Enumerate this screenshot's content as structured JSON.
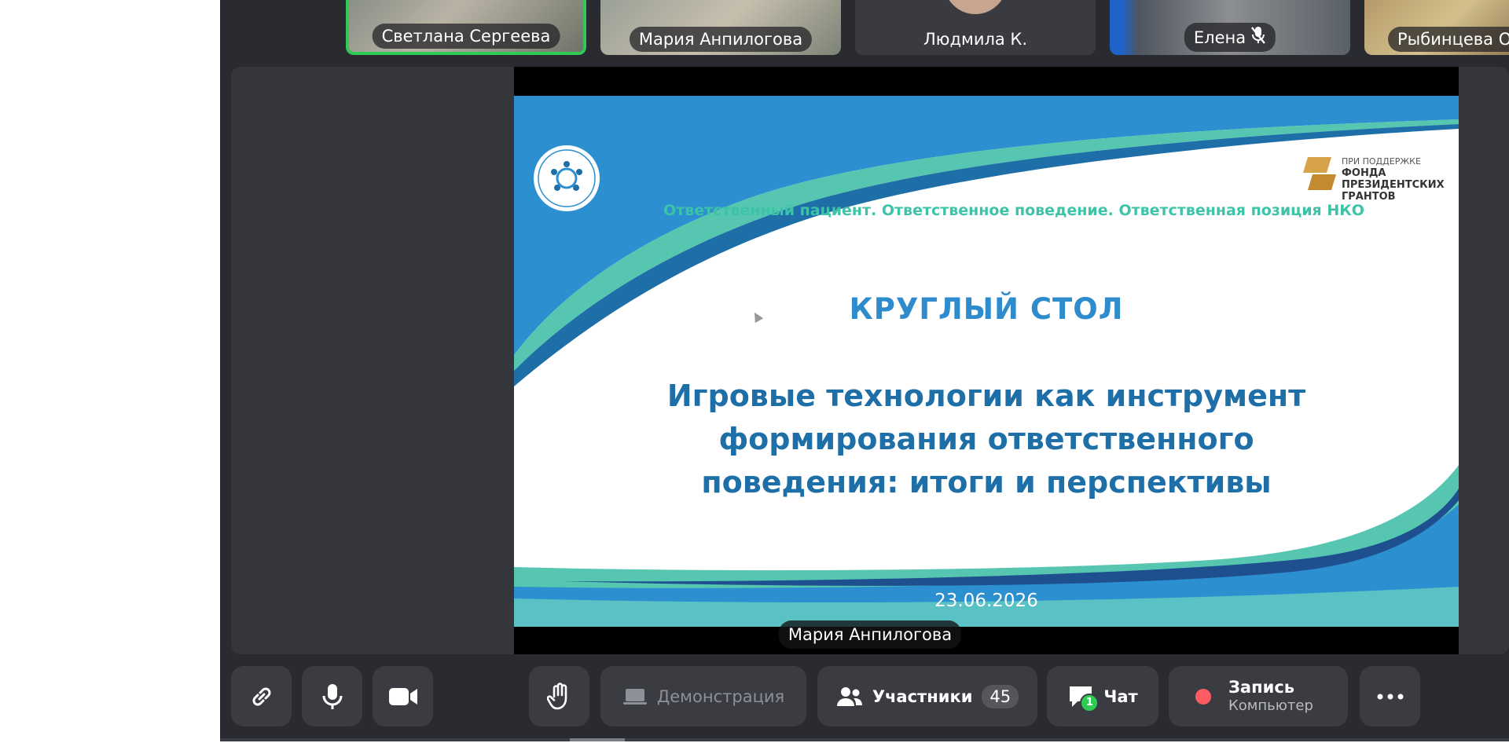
{
  "participants": [
    {
      "name": "Светлана Сергеева",
      "active": true
    },
    {
      "name": "Мария Анпилогова"
    },
    {
      "name": "Людмила К."
    },
    {
      "name": "Елена",
      "muted": true
    },
    {
      "name": "Рыбинцева Ол"
    }
  ],
  "slide": {
    "top_line": "Ответственный пациент. Ответственное поведение. Ответственная позиция НКО",
    "grant_small": "ПРИ ПОДДЕРЖКЕ",
    "grant_line1": "ФОНДА",
    "grant_line2": "ПРЕЗИДЕНТСКИХ",
    "grant_line3": "ГРАНТОВ",
    "heading": "КРУГЛЫЙ СТОЛ",
    "title_line1": "Игровые технологии как инструмент",
    "title_line2": "формирования ответственного",
    "title_line3": "поведения: итоги и перспективы",
    "date": "23.06.2026"
  },
  "presenter": "Мария Анпилогова",
  "toolbar": {
    "demo_label": "Демонстрация",
    "participants_label": "Участники",
    "participants_count": "45",
    "chat_label": "Чат",
    "chat_badge": "1",
    "record_label": "Запись",
    "record_sub": "Компьютер"
  },
  "colors": {
    "active_border": "#2ecc55",
    "slide_blue": "#1e6fa8",
    "slide_teal": "#3cc3a8",
    "record": "#ff5b63"
  }
}
